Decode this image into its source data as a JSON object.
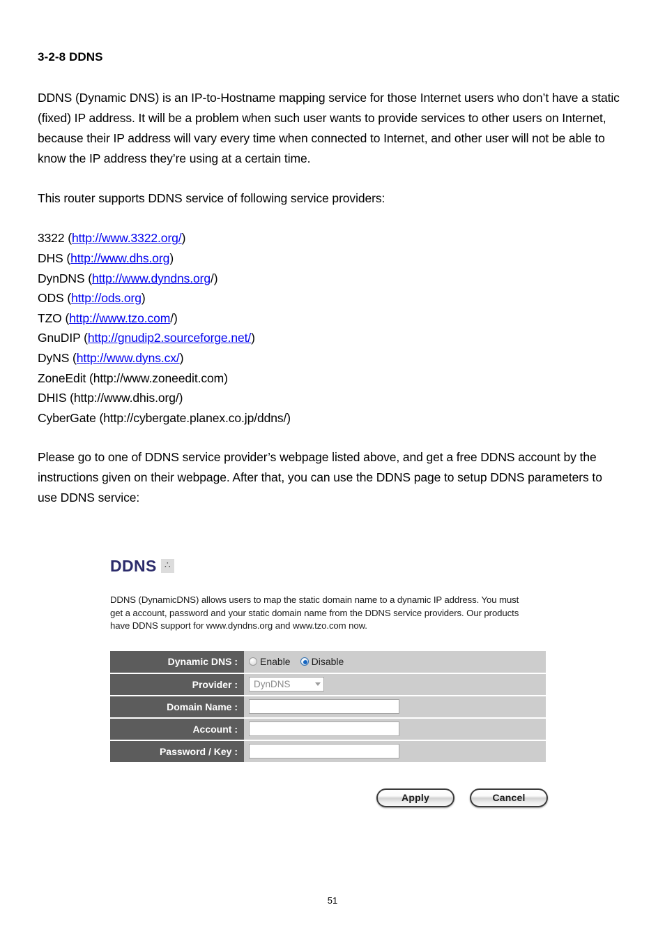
{
  "document": {
    "heading": "3-2-8 DDNS",
    "intro_paragraph": "DDNS (Dynamic DNS) is an IP-to-Hostname mapping service for those Internet users who don’t have a static (fixed) IP address. It will be a problem when such user wants to provide services to other users on Internet, because their IP address will vary every time when connected to Internet, and other user will not be able to know the IP address they’re using at a certain time.",
    "providers_intro": "This router supports DDNS service of following service providers:",
    "closing_paragraph": "Please go to one of DDNS service provider’s webpage listed above, and get a free DDNS account by the instructions given on their webpage. After that, you can use the DDNS page to setup DDNS parameters to use DDNS service:",
    "page_number": "51"
  },
  "providers": [
    {
      "name": "3322",
      "open": " (",
      "url": "http://www.3322.org/",
      "linked": true,
      "close": ")"
    },
    {
      "name": "DHS",
      "open": " (",
      "url": "http://www.dhs.org",
      "linked": true,
      "close": ")"
    },
    {
      "name": "DynDNS",
      "open": " (",
      "url": "http://www.dyndns.org",
      "linked": true,
      "close": "/)"
    },
    {
      "name": "ODS",
      "open": " (",
      "url": "http://ods.org",
      "linked": true,
      "close": ")"
    },
    {
      "name": "TZO",
      "open": " (",
      "url": "http://www.tzo.com",
      "linked": true,
      "close": "/)"
    },
    {
      "name": "GnuDIP",
      "open": " (",
      "url": "http://gnudip2.sourceforge.net/",
      "linked": true,
      "close": ")"
    },
    {
      "name": "DyNS",
      "open": " (",
      "url": "http://www.dyns.cx/",
      "linked": true,
      "close": ")"
    },
    {
      "name": "ZoneEdit",
      "open": " (",
      "url": "http://www.zoneedit.com",
      "linked": false,
      "close": ")"
    },
    {
      "name": "DHIS",
      "open": " (",
      "url": "http://www.dhis.org/",
      "linked": false,
      "close": ")"
    },
    {
      "name": "CyberGate",
      "open": " (",
      "url": "http://cybergate.planex.co.jp/ddns/",
      "linked": false,
      "close": ")"
    }
  ],
  "router_ui": {
    "title": "DDNS",
    "help_icon_glyph": "∴",
    "description": "DDNS (DynamicDNS) allows users to map the static domain name to a dynamic IP address. You must get a account, password and your static domain name from the DDNS service providers. Our products have DDNS support for www.dyndns.org and www.tzo.com now.",
    "fields": {
      "dynamic_dns_label": "Dynamic DNS :",
      "enable_label": "Enable",
      "disable_label": "Disable",
      "selected_state": "Disable",
      "provider_label": "Provider :",
      "provider_value": "DynDNS",
      "domain_name_label": "Domain Name :",
      "domain_name_value": "",
      "account_label": "Account :",
      "account_value": "",
      "password_label": "Password / Key :",
      "password_value": ""
    },
    "buttons": {
      "apply": "Apply",
      "cancel": "Cancel"
    },
    "colors": {
      "title": "#2b2b6b",
      "label_bg": "#5c5c5c",
      "value_bg": "#cdcdcd",
      "radio_accent": "#1565c0"
    }
  }
}
